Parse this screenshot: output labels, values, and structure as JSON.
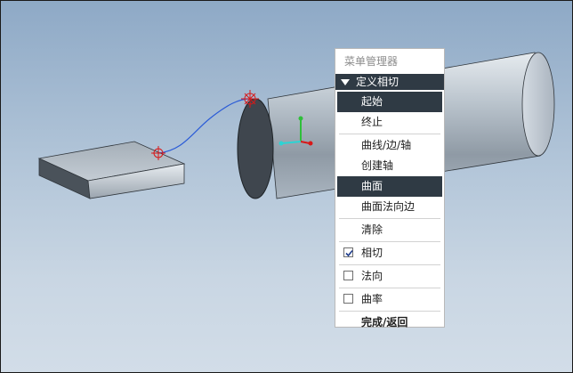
{
  "menu": {
    "title": "菜单管理器",
    "header": "定义相切",
    "items": [
      {
        "label": "起始",
        "selected": true
      },
      {
        "label": "终止"
      },
      {
        "label": "曲线/边/轴"
      },
      {
        "label": "创建轴"
      },
      {
        "label": "曲面",
        "selected": true
      },
      {
        "label": "曲面法向边"
      },
      {
        "label": "清除"
      },
      {
        "label": "相切",
        "checked": true
      },
      {
        "label": "法向",
        "checked": false
      },
      {
        "label": "曲率",
        "checked": false
      },
      {
        "label": "完成/返回"
      }
    ]
  },
  "colors": {
    "background_top": "#8ea9c6",
    "background_bottom": "#d2dde8",
    "menu_highlight": "#2f3a44",
    "curve": "#2a5bd7",
    "datum_marker": "#d81818"
  },
  "icons": [
    "triangle-down-icon",
    "checkmark-icon",
    "datum-point-icon",
    "coordinate-axes-icon"
  ]
}
